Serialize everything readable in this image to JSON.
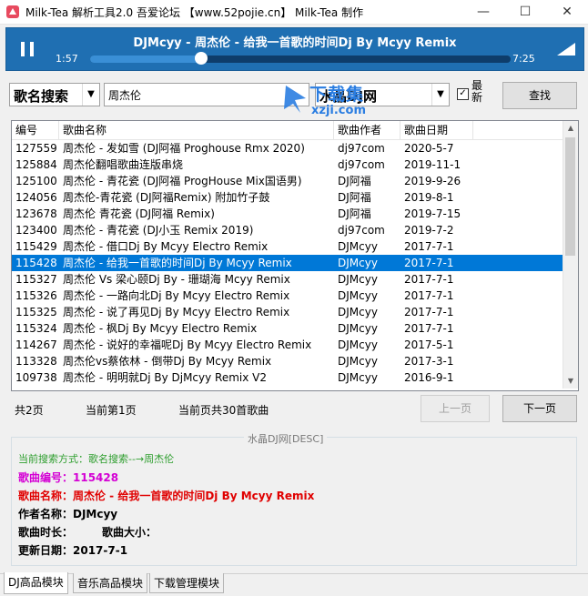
{
  "window": {
    "title": "Milk-Tea 解析工具2.0    吾爱论坛 【www.52pojie.cn】 Milk-Tea 制作",
    "minimize": "—",
    "maximize": "☐",
    "close": "✕"
  },
  "player": {
    "track_title": "DJMcyy - 周杰伦 - 给我一首歌的时间Dj By Mcyy Remix",
    "current_time": "1:57",
    "total_time": "7:25",
    "progress_fraction": 0.263
  },
  "search": {
    "mode": "歌名搜索",
    "keyword": "周杰伦",
    "source": "水晶DJ网",
    "latest_label": "最新",
    "latest_checked": true,
    "search_button": "查找"
  },
  "watermark": {
    "text": "下载集",
    "url": "xzji.com"
  },
  "table": {
    "headers": [
      "编号",
      "歌曲名称",
      "歌曲作者",
      "歌曲日期"
    ],
    "rows": [
      [
        "127559",
        "周杰伦 - 发如雪 (DJ阿福 Proghouse Rmx 2020)",
        "dj97com",
        "2020-5-7"
      ],
      [
        "125884",
        "周杰伦翻唱歌曲连版串烧",
        "dj97com",
        "2019-11-1"
      ],
      [
        "125100",
        "周杰伦 - 青花瓷 (DJ阿福 ProgHouse Mix国语男)",
        "DJ阿福",
        "2019-9-26"
      ],
      [
        "124056",
        "周杰伦-青花瓷 (DJ阿福Remix) 附加竹子鼓",
        "DJ阿福",
        "2019-8-1"
      ],
      [
        "123678",
        "周杰伦 青花瓷 (DJ阿福 Remix)",
        "DJ阿福",
        "2019-7-15"
      ],
      [
        "123400",
        "周杰伦 - 青花瓷 (DJ小玉 Remix 2019)",
        "dj97com",
        "2019-7-2"
      ],
      [
        "115429",
        "周杰伦 - 借口Dj By Mcyy Electro Remix",
        "DJMcyy",
        "2017-7-1"
      ],
      [
        "115428",
        "周杰伦 - 给我一首歌的时间Dj By Mcyy Remix",
        "DJMcyy",
        "2017-7-1"
      ],
      [
        "115327",
        "周杰伦 Vs 梁心颐Dj By - 珊瑚海 Mcyy Remix",
        "DJMcyy",
        "2017-7-1"
      ],
      [
        "115326",
        "周杰伦 - 一路向北Dj By Mcyy Electro Remix",
        "DJMcyy",
        "2017-7-1"
      ],
      [
        "115325",
        "周杰伦 - 说了再见Dj By Mcyy Electro Remix",
        "DJMcyy",
        "2017-7-1"
      ],
      [
        "115324",
        "周杰伦 - 枫Dj By Mcyy Electro Remix",
        "DJMcyy",
        "2017-7-1"
      ],
      [
        "114267",
        "周杰伦 - 说好的幸福呢Dj By Mcyy Electro Remix",
        "DJMcyy",
        "2017-5-1"
      ],
      [
        "113328",
        "周杰伦vs蔡依林 - 倒带Dj By Mcyy Remix",
        "DJMcyy",
        "2017-3-1"
      ],
      [
        "109738",
        "周杰伦 - 明明就Dj By DjMcyy Remix V2",
        "DJMcyy",
        "2016-9-1"
      ]
    ],
    "selected_index": 7
  },
  "pagination": {
    "total_pages": "共2页",
    "current_page": "当前第1页",
    "page_count": "当前页共30首歌曲",
    "prev_button": "上一页",
    "next_button": "下一页"
  },
  "details": {
    "group_title": "水晶DJ网[DESC]",
    "search_method": "当前搜索方式：歌名搜索--→周杰伦",
    "song_id": "歌曲编号：115428",
    "song_name": "歌曲名称：周杰伦 - 给我一首歌的时间Dj By Mcyy Remix",
    "author": "作者名称：DJMcyy",
    "duration": "歌曲时长：",
    "size": "歌曲大小：",
    "update_date": "更新日期：2017-7-1"
  },
  "tabs": [
    "DJ高品模块",
    "音乐高品模块",
    "下载管理模块"
  ],
  "colors": {
    "accent": "#1f6fb2",
    "selection": "#0078d7",
    "search_method": "#2e9e2e",
    "song_id": "#d400d4",
    "song_name": "#e00000"
  }
}
